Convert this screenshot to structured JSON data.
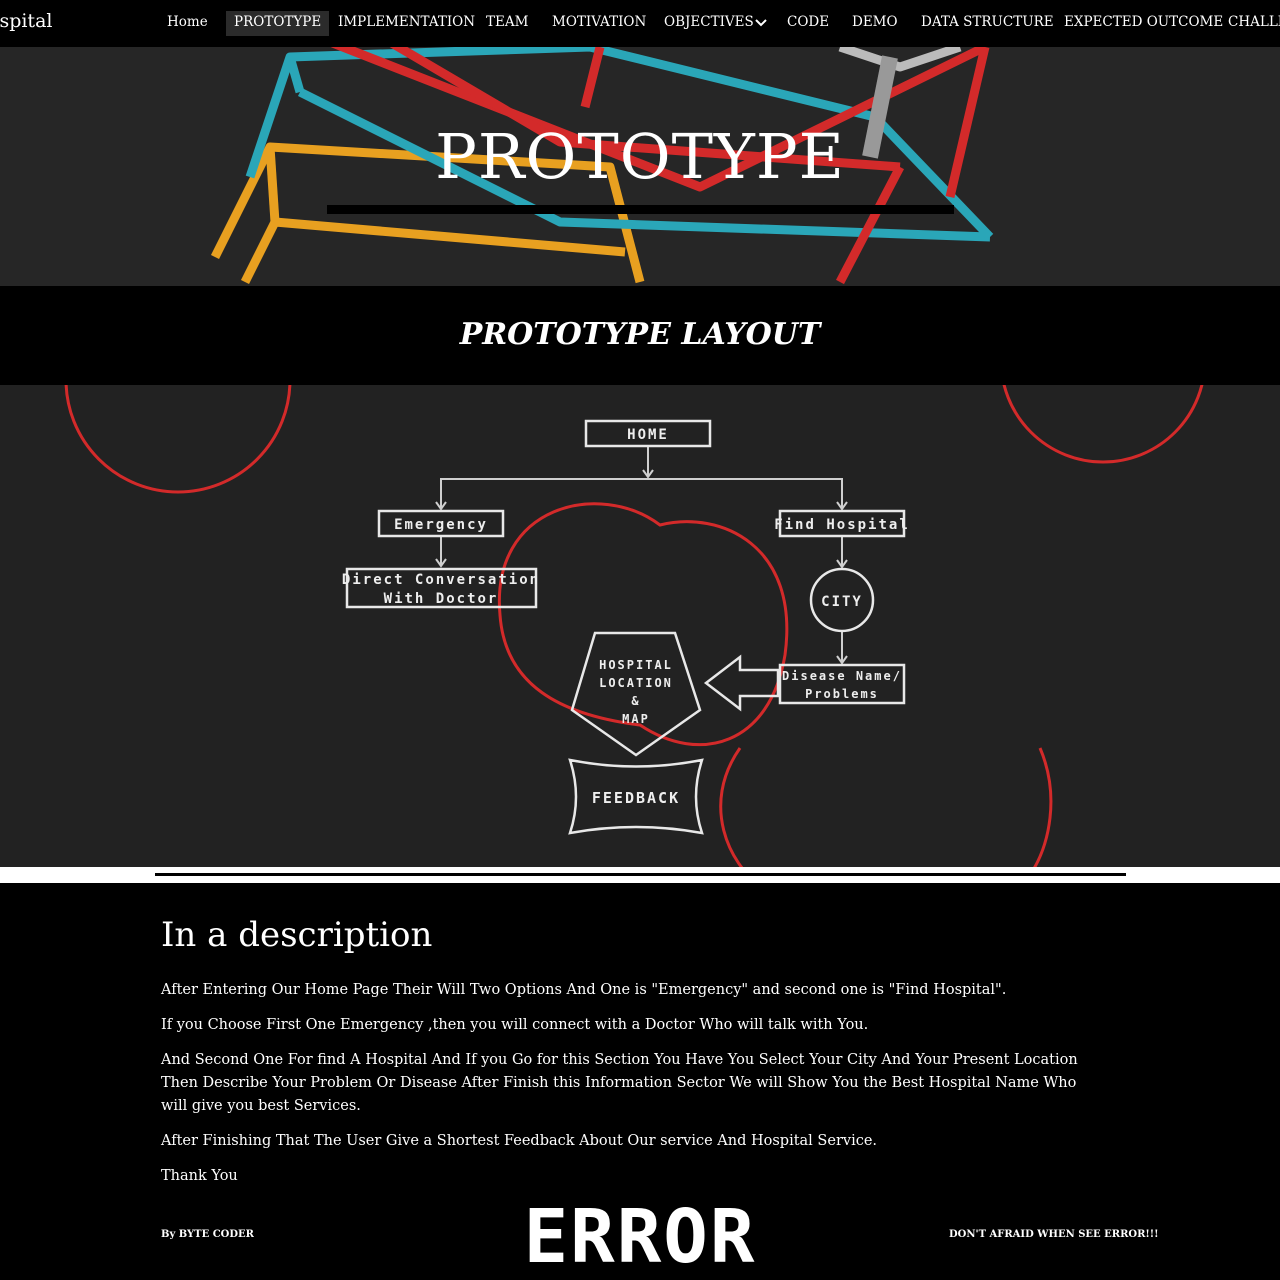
{
  "nav": {
    "site_title": "ospital",
    "items": [
      {
        "label": "Home"
      },
      {
        "label": "PROTOTYPE"
      },
      {
        "label": "IMPLEMENTATION"
      },
      {
        "label": "TEAM"
      },
      {
        "label": "MOTIVATION"
      },
      {
        "label": "OBJECTIVES"
      },
      {
        "label": "CODE"
      },
      {
        "label": "DEMO"
      },
      {
        "label": "DATA STRUCTURE"
      },
      {
        "label": "EXPECTED OUTCOME"
      },
      {
        "label": "CHALLE"
      }
    ],
    "active": "PROTOTYPE"
  },
  "hero": {
    "title": "PROTOTYPE"
  },
  "section": {
    "title": "PROTOTYPE LAYOUT"
  },
  "diagram": {
    "home": "HOME",
    "emergency": "Emergency",
    "find_hospital": "Find Hospital",
    "direct_line1": "Direct Conversation",
    "direct_line2": "With Doctor",
    "city": "CITY",
    "disease_line1": "Disease Name/",
    "disease_line2": "Problems",
    "hosp_line1": "HOSPITAL",
    "hosp_line2": "LOCATION",
    "hosp_line3": "&",
    "hosp_line4": "MAP",
    "feedback": "FEEDBACK"
  },
  "description": {
    "heading": "In a description",
    "paragraphs": [
      "After Entering Our Home Page Their Will Two Options And One is \"Emergency\" and second one is \"Find Hospital\".",
      "If you Choose First One Emergency ,then you will connect with a Doctor Who will talk with You.",
      "And Second One For find A Hospital And If you Go for this Section You Have You Select Your City And Your Present Location Then Describe Your Problem Or Disease After Finish this Information Sector We will Show You the Best Hospital Name Who will give you best Services.",
      "After Finishing That The User Give a Shortest Feedback About Our service And Hospital Service.",
      "Thank You"
    ]
  },
  "footer": {
    "left": "By BYTE CODER",
    "right": "DON'T AFRAID WHEN SEE ERROR!!!",
    "logo_text": "ERROR"
  },
  "colors": {
    "red": "#d32a2a",
    "cyan": "#2aa6b8",
    "orange": "#e8a020"
  }
}
